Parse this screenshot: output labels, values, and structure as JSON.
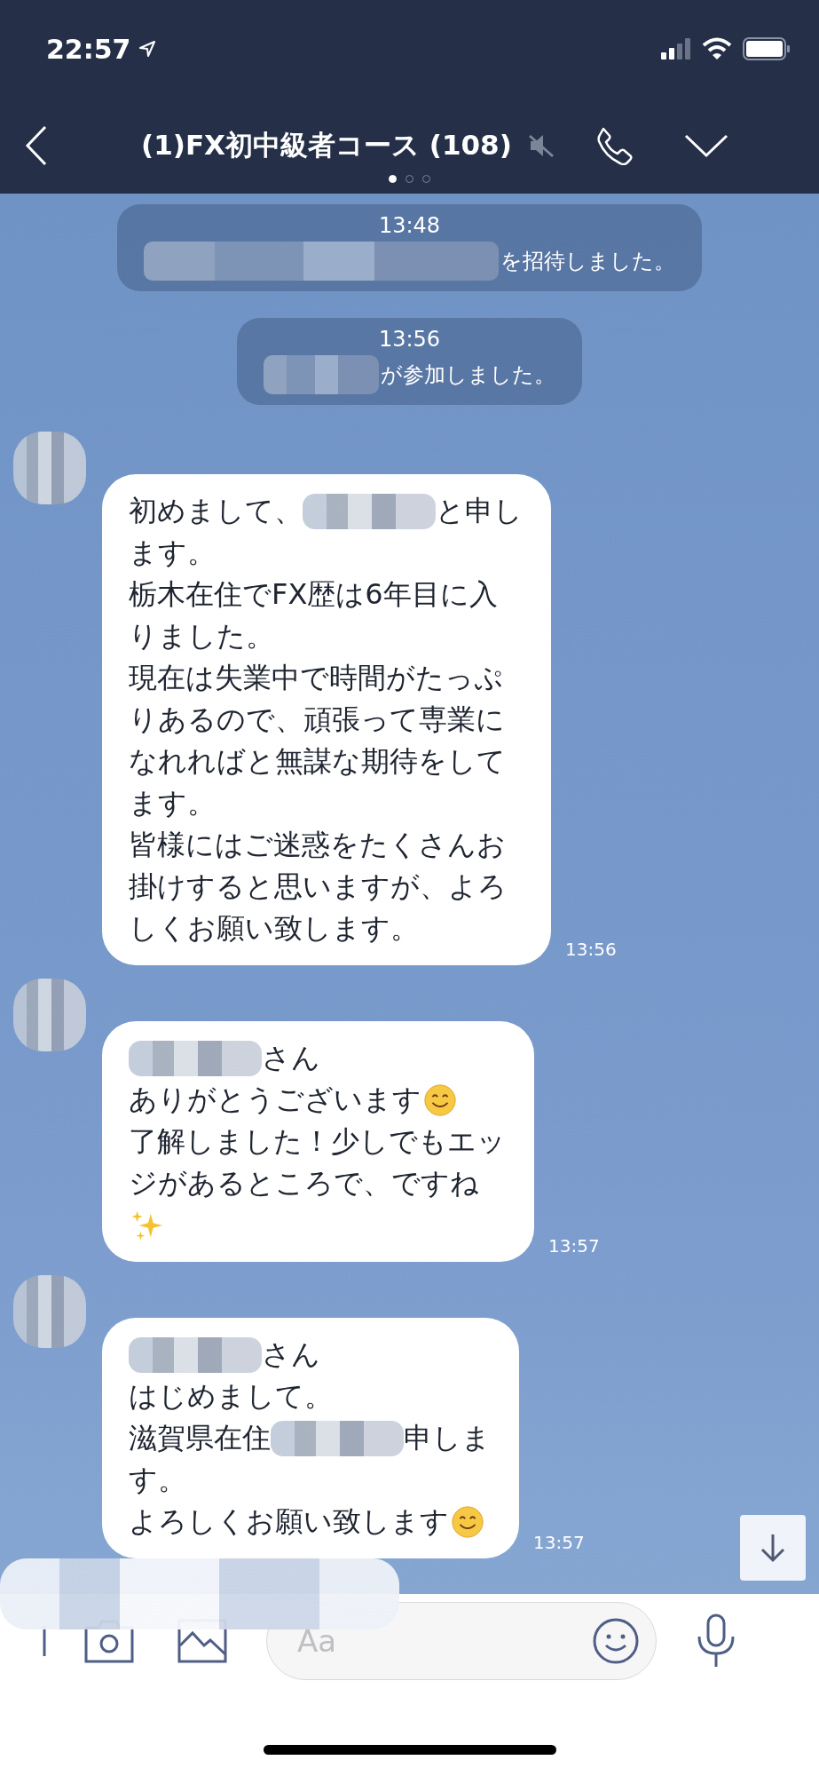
{
  "status_bar": {
    "time": "22:57"
  },
  "header": {
    "title": "(1)FX初中級者コース (108)",
    "muted": true,
    "pages": [
      {
        "selected": true
      },
      {
        "selected": false
      },
      {
        "selected": false
      }
    ]
  },
  "system_messages": [
    {
      "time": "13:48",
      "text": "を招待しました。"
    },
    {
      "time": "13:56",
      "text": "が参加しました。"
    }
  ],
  "messages": [
    {
      "time": "13:56",
      "lines": [
        [
          {
            "kind": "text",
            "text": "初めまして、"
          },
          {
            "kind": "redacted"
          },
          {
            "kind": "text",
            "text": "と申し"
          }
        ],
        [
          {
            "kind": "text",
            "text": "ます。"
          }
        ],
        [
          {
            "kind": "text",
            "text": "栃木在住でFX歴は6年目に入"
          }
        ],
        [
          {
            "kind": "text",
            "text": "りました。"
          }
        ],
        [
          {
            "kind": "text",
            "text": "現在は失業中で時間がたっぷ"
          }
        ],
        [
          {
            "kind": "text",
            "text": "りあるので、頑張って専業に"
          }
        ],
        [
          {
            "kind": "text",
            "text": "なれればと無謀な期待をして"
          }
        ],
        [
          {
            "kind": "text",
            "text": "ます。"
          }
        ],
        [
          {
            "kind": "text",
            "text": "皆様にはご迷惑をたくさんお"
          }
        ],
        [
          {
            "kind": "text",
            "text": "掛けすると思いますが、よろ"
          }
        ],
        [
          {
            "kind": "text",
            "text": "しくお願い致します。"
          }
        ]
      ]
    },
    {
      "time": "13:57",
      "lines": [
        [
          {
            "kind": "redacted"
          },
          {
            "kind": "text",
            "text": "さん"
          }
        ],
        [
          {
            "kind": "text",
            "text": "ありがとうございます"
          },
          {
            "kind": "smiley"
          }
        ],
        [
          {
            "kind": "text",
            "text": "了解しました！少しでもエッ"
          }
        ],
        [
          {
            "kind": "text",
            "text": "ジがあるところで、ですね"
          }
        ],
        [
          {
            "kind": "sparkles"
          }
        ]
      ]
    },
    {
      "time": "13:57",
      "lines": [
        [
          {
            "kind": "redacted"
          },
          {
            "kind": "text",
            "text": "さん"
          }
        ],
        [
          {
            "kind": "text",
            "text": "はじめまして。"
          }
        ],
        [
          {
            "kind": "text",
            "text": "滋賀県在住"
          },
          {
            "kind": "redacted"
          },
          {
            "kind": "text",
            "text": "申しま"
          }
        ],
        [
          {
            "kind": "text",
            "text": "す。"
          }
        ],
        [
          {
            "kind": "text",
            "text": "よろしくお願い致します"
          },
          {
            "kind": "smiley"
          }
        ]
      ]
    }
  ],
  "input": {
    "placeholder": "Aa"
  }
}
